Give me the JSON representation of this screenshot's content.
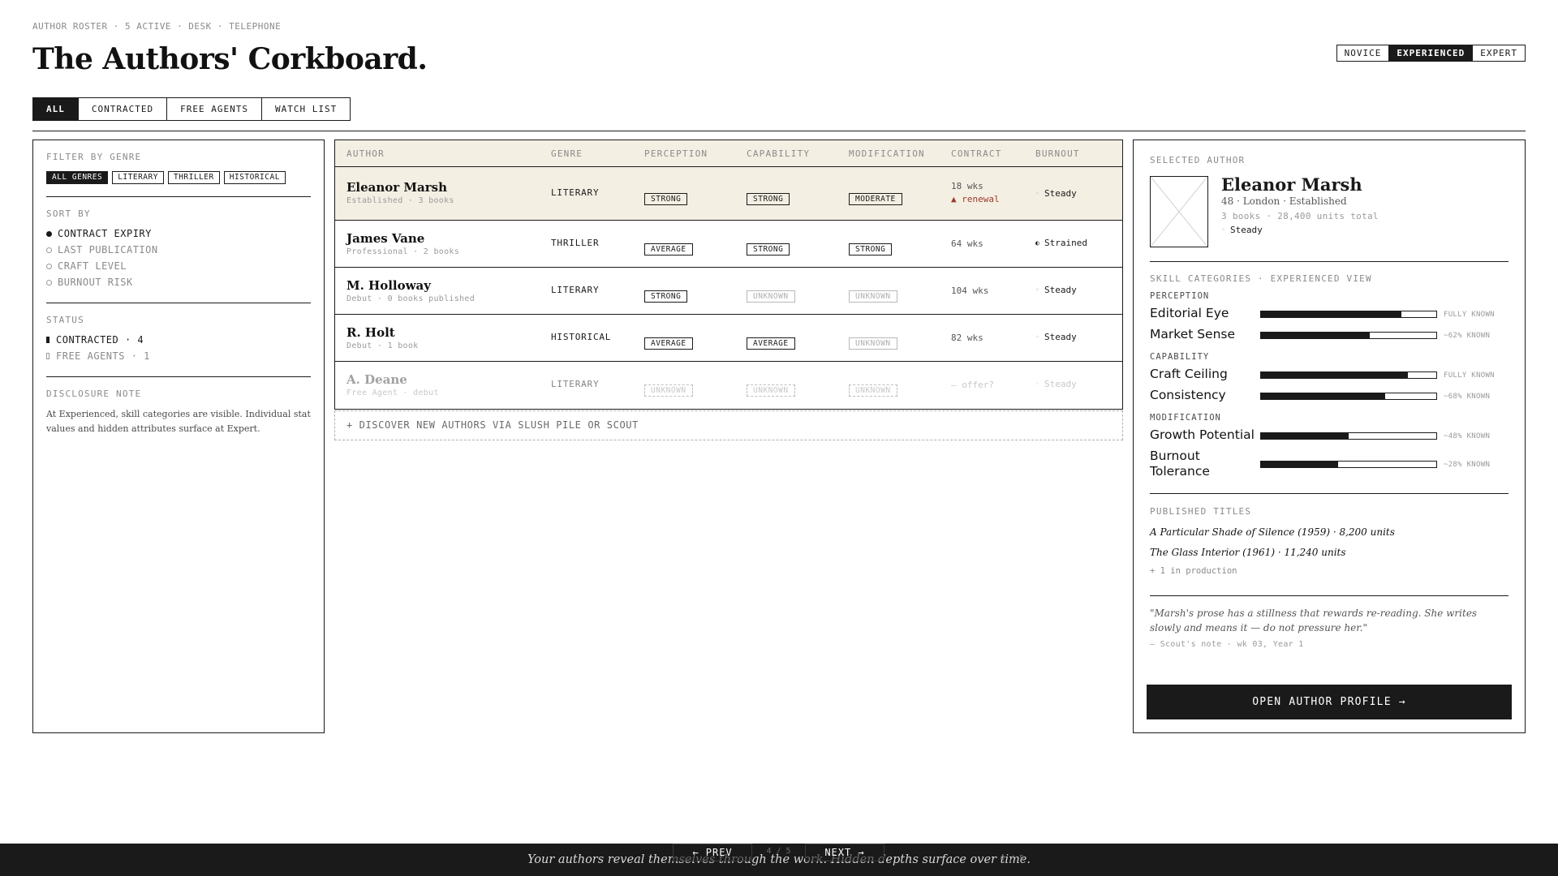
{
  "header": {
    "eyebrow": "AUTHOR ROSTER · 5 ACTIVE · DESK · TELEPHONE",
    "title": "The Authors' Corkboard.",
    "levels": [
      "NOVICE",
      "EXPERIENCED",
      "EXPERT"
    ],
    "active_level": "EXPERIENCED",
    "tabs": [
      "ALL",
      "CONTRACTED",
      "FREE AGENTS",
      "WATCH LIST"
    ],
    "active_tab": "ALL"
  },
  "filters": {
    "genre_label": "FILTER BY GENRE",
    "genres": [
      "ALL GENRES",
      "LITERARY",
      "THRILLER",
      "HISTORICAL"
    ],
    "active_genre": "ALL GENRES",
    "sort_label": "SORT BY",
    "sort_options": [
      "CONTRACT EXPIRY",
      "LAST PUBLICATION",
      "CRAFT LEVEL",
      "BURNOUT RISK"
    ],
    "active_sort": "CONTRACT EXPIRY",
    "status_label": "STATUS",
    "status_contracted": "CONTRACTED · 4",
    "status_free": "FREE AGENTS · 1",
    "note_label": "DISCLOSURE NOTE",
    "note_text": "At Experienced, skill categories are visible. Individual stat values and hidden attributes surface at Expert."
  },
  "table": {
    "columns": [
      "AUTHOR",
      "GENRE",
      "PERCEPTION",
      "CAPABILITY",
      "MODIFICATION",
      "CONTRACT",
      "BURNOUT"
    ],
    "rows": [
      {
        "name": "Eleanor Marsh",
        "sub": "Established · 3 books",
        "genre": "LITERARY",
        "perception": "STRONG",
        "capability": "STRONG",
        "modification": "MODERATE",
        "contract": "18 wks",
        "contract_note": "▲ renewal",
        "burnout": "Steady"
      },
      {
        "name": "James Vane",
        "sub": "Professional · 2 books",
        "genre": "THRILLER",
        "perception": "AVERAGE",
        "capability": "STRONG",
        "modification": "STRONG",
        "contract": "64 wks",
        "contract_note": "",
        "burnout": "Strained"
      },
      {
        "name": "M. Holloway",
        "sub": "Debut · 0 books published",
        "genre": "LITERARY",
        "perception": "STRONG",
        "capability": "UNKNOWN",
        "modification": "UNKNOWN",
        "contract": "104 wks",
        "contract_note": "",
        "burnout": "Steady"
      },
      {
        "name": "R. Holt",
        "sub": "Debut · 1 book",
        "genre": "HISTORICAL",
        "perception": "AVERAGE",
        "capability": "AVERAGE",
        "modification": "UNKNOWN",
        "contract": "82 wks",
        "contract_note": "",
        "burnout": "Steady"
      },
      {
        "name": "A. Deane",
        "sub": "Free Agent · debut",
        "genre": "LITERARY",
        "perception": "UNKNOWN",
        "capability": "UNKNOWN",
        "modification": "UNKNOWN",
        "contract": "— offer?",
        "contract_note": "",
        "burnout": "Steady"
      }
    ],
    "discover": "+ DISCOVER NEW AUTHORS VIA SLUSH PILE OR SCOUT"
  },
  "selected": {
    "label": "SELECTED AUTHOR",
    "name": "Eleanor Marsh",
    "meta": "48 · London · Established",
    "sub": "3 books · 28,400 units total",
    "burnout": "Steady",
    "skills_label": "SKILL CATEGORIES · EXPERIENCED VIEW",
    "categories": {
      "perception": "PERCEPTION",
      "capability": "CAPABILITY",
      "modification": "MODIFICATION"
    },
    "skills": [
      {
        "name": "Editorial Eye",
        "value": 0.8,
        "known": "FULLY KNOWN"
      },
      {
        "name": "Market Sense",
        "value": 0.62,
        "known": "~62% KNOWN"
      },
      {
        "name": "Craft Ceiling",
        "value": 0.84,
        "known": "FULLY KNOWN"
      },
      {
        "name": "Consistency",
        "value": 0.71,
        "known": "~68% KNOWN"
      },
      {
        "name": "Growth Potential",
        "value": 0.5,
        "known": "~48% KNOWN"
      },
      {
        "name": "Burnout Tolerance",
        "value": 0.44,
        "known": "~28% KNOWN"
      }
    ],
    "titles_label": "PUBLISHED TITLES",
    "titles": [
      "A Particular Shade of Silence (1959) · 8,200 units",
      "The Glass Interior (1961) · 11,240 units"
    ],
    "in_production": "+ 1 in production",
    "quote": "\"Marsh's prose has a stillness that rewards re-reading. She writes slowly and means it — do not pressure her.\"",
    "quote_source": "— Scout's note · wk 03, Year 1",
    "open_button": "OPEN AUTHOR PROFILE →"
  },
  "footer": {
    "caption": "Your authors reveal themselves through the work. Hidden depths surface over time.",
    "prev": "← PREV",
    "next": "NEXT →",
    "counter": "4 / 5"
  }
}
